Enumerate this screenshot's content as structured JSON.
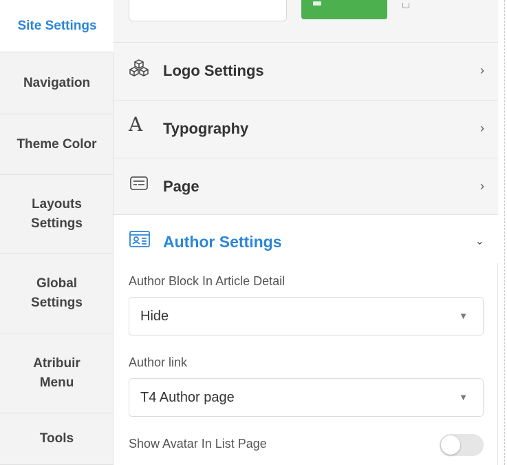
{
  "tabs": [
    {
      "label": "Site Settings",
      "active": true
    },
    {
      "label": "Navigation",
      "active": false
    },
    {
      "label": "Theme Color",
      "active": false
    },
    {
      "label": "Layouts Settings",
      "active": false
    },
    {
      "label": "Global Settings",
      "active": false
    },
    {
      "label": "Atribuir Menu",
      "active": false
    },
    {
      "label": "Tools",
      "active": false
    }
  ],
  "sections": [
    {
      "label": "Logo Settings",
      "icon": "cubes-icon"
    },
    {
      "label": "Typography",
      "icon": "typography-icon"
    },
    {
      "label": "Page",
      "icon": "page-icon"
    }
  ],
  "author": {
    "title": "Author Settings",
    "icon": "id-card-icon",
    "block_label": "Author Block In Article Detail",
    "block_value": "Hide",
    "link_label": "Author link",
    "link_value": "T4 Author page",
    "avatar_label": "Show Avatar In List Page",
    "avatar_on": false
  },
  "colors": {
    "accent": "#2b86d6",
    "save_green": "#4cb04f"
  }
}
